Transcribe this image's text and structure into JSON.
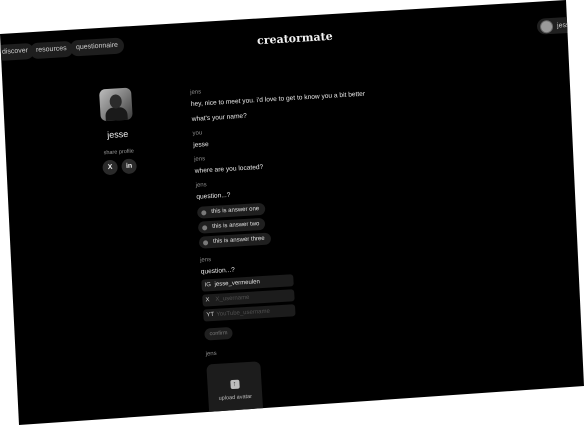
{
  "nav": {
    "items": [
      {
        "label": "discover"
      },
      {
        "label": "resources"
      },
      {
        "label": "questionnaire"
      }
    ],
    "brand": "creatormate",
    "user_label": "jesse"
  },
  "profile": {
    "name": "jesse",
    "share_label": "share profile",
    "social_x": "X",
    "social_linkedin": "in"
  },
  "chat": {
    "m1_sender": "jens",
    "m1_line1": "hey, nice to meet you. i'd love to get to know you a bit better",
    "m1_line2": "what's your name?",
    "m2_sender": "you",
    "m2_text": "jesse",
    "m3_sender": "jens",
    "m3_text": "where are you located?",
    "m4_sender": "jens",
    "m4_text": "question...?",
    "answers": [
      "this is answer one",
      "this is answer two",
      "this is answer three"
    ],
    "m5_sender": "jens",
    "m5_text": "question...?",
    "socials": [
      {
        "prefix": "IG",
        "value": "jesse_vermeulen",
        "placeholder": ""
      },
      {
        "prefix": "X",
        "value": "",
        "placeholder": "X_username"
      },
      {
        "prefix": "YT",
        "value": "",
        "placeholder": "YouTube_username"
      }
    ],
    "confirm_label": "confirm",
    "m6_sender": "jens",
    "upload_label": "upload avatar"
  },
  "colors": {
    "background": "#000000",
    "pill": "#1e1e1e",
    "text": "#ececec",
    "muted": "#8a8a8a"
  }
}
